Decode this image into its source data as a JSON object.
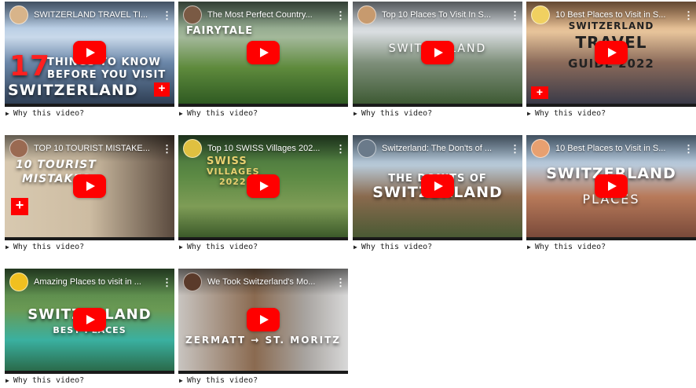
{
  "why_label": "Why this video?",
  "colors": {
    "play_button": "#ff0000",
    "overlay_text": "#ffffff"
  },
  "videos": [
    {
      "title": "SWITZERLAND TRAVEL TI...",
      "overlay_lines": [
        "17",
        "THINGS TO KNOW",
        "BEFORE YOU VISIT",
        "SWITZERLAND"
      ]
    },
    {
      "title": "The Most Perfect Country...",
      "overlay_lines": [
        "FAIRYTALE"
      ]
    },
    {
      "title": "Top 10 Places To Visit In S...",
      "overlay_lines": [
        "SWITZERLAND"
      ]
    },
    {
      "title": "10 Best Places to Visit in S...",
      "overlay_lines": [
        "SWITZERLAND",
        "TRAVEL",
        "GUIDE 2022"
      ]
    },
    {
      "title": "TOP 10 TOURIST MISTAKE...",
      "overlay_lines": [
        "10 TOURIST",
        "MISTAKES"
      ]
    },
    {
      "title": "Top 10 SWISS Villages 202...",
      "overlay_lines": [
        "SWISS",
        "VILLAGES",
        "2022"
      ]
    },
    {
      "title": "Switzerland: The Don'ts of ...",
      "overlay_lines": [
        "THE DON'TS OF",
        "SWITZERLAND"
      ]
    },
    {
      "title": "10 Best Places to Visit in S...",
      "overlay_lines": [
        "SWITZERLAND",
        "PLACES"
      ]
    },
    {
      "title": "Amazing Places to visit in ...",
      "overlay_lines": [
        "SWITZERLAND",
        "BEST PLACES"
      ]
    },
    {
      "title": "We Took Switzerland's Mo...",
      "overlay_lines": [
        "ZERMATT → ST. MORITZ"
      ]
    }
  ]
}
